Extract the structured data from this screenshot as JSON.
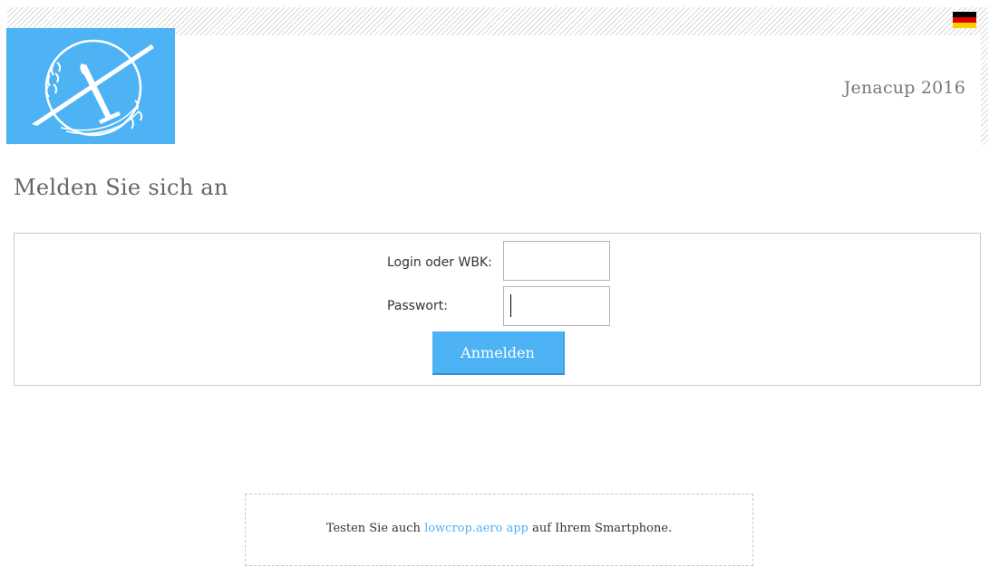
{
  "header": {
    "event_title": "Jenacup 2016",
    "language": "Deutsch",
    "flag_colors": [
      "#000000",
      "#dd0000",
      "#ffce00"
    ],
    "logo_bg_color": "#4db3f5"
  },
  "page": {
    "title": "Melden Sie sich an"
  },
  "login_form": {
    "login_label": "Login oder WBK:",
    "login_value": "",
    "password_label": "Passwort:",
    "password_value": "",
    "submit_label": "Anmelden"
  },
  "promo": {
    "text_before": "Testen Sie auch ",
    "link_text": "lowcrop.aero app",
    "text_after": " auf Ihrem Smartphone."
  },
  "colors": {
    "accent": "#4db3f5",
    "link": "#4db3f5"
  }
}
